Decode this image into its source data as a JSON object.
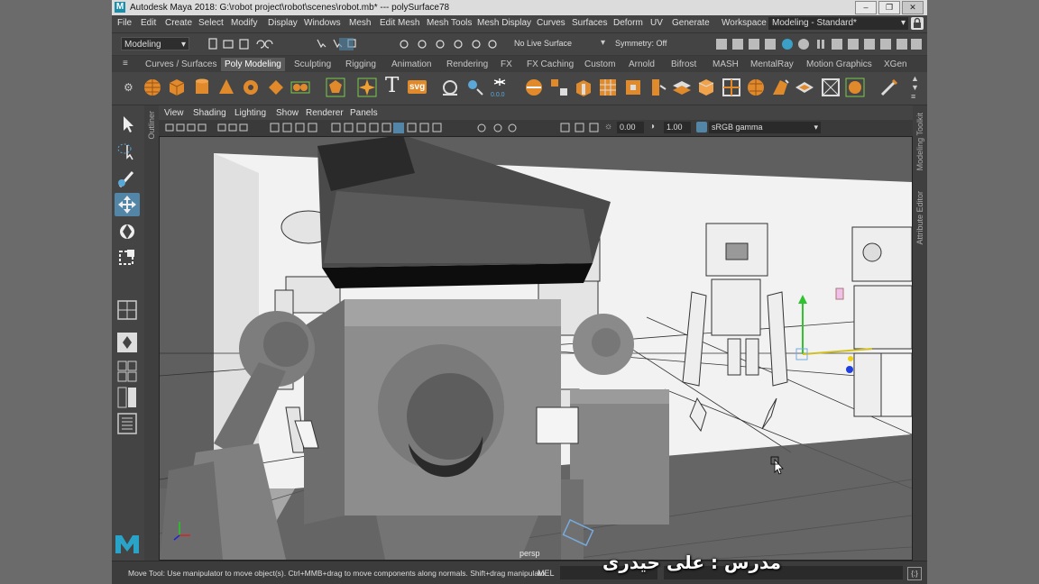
{
  "window": {
    "title": "Autodesk Maya 2018: G:\\robot project\\robot\\scenes\\robot.mb*  ---  polySurface78",
    "logo": "M"
  },
  "menu": [
    "File",
    "Edit",
    "Create",
    "Select",
    "Modify",
    "Display",
    "Windows",
    "Mesh",
    "Edit Mesh",
    "Mesh Tools",
    "Mesh Display",
    "Curves",
    "Surfaces",
    "Deform",
    "UV",
    "Generate"
  ],
  "workspace": {
    "label": "Workspace :",
    "value": "Modeling - Standard*"
  },
  "statusline": {
    "mode": "Modeling",
    "live_surface": "No Live Surface",
    "symmetry": "Symmetry: Off"
  },
  "shelf_tabs": [
    "Curves / Surfaces",
    "Poly Modeling",
    "Sculpting",
    "Rigging",
    "Animation",
    "Rendering",
    "FX",
    "FX Caching",
    "Custom",
    "Arnold",
    "Bifrost",
    "MASH",
    "MentalRay",
    "Motion Graphics",
    "XGen"
  ],
  "active_shelf_tab": "Poly Modeling",
  "shelf_text_icons": {
    "text_tool": "T",
    "svg_tool": "svg"
  },
  "panel": {
    "menu": [
      "View",
      "Shading",
      "Lighting",
      "Show",
      "Renderer",
      "Panels"
    ],
    "exposure": "0.00",
    "gamma": "1.00",
    "color_space": "sRGB gamma",
    "camera": "persp"
  },
  "side_labels": {
    "outliner": "Outliner",
    "modeling_toolkit": "Modeling Toolkit",
    "attribute_editor": "Attribute Editor"
  },
  "help_line": "Move Tool: Use manipulator to move object(s). Ctrl+MMB+drag to move components along normals. Shift+drag manipulato",
  "command_line": {
    "label": "MEL"
  },
  "overlay": {
    "teacher": "مدرس : علی حیدری"
  },
  "colors": {
    "accent": "#5285a6",
    "shelf_orange": "#e08a2c",
    "viewport_bg": "#5f5f5f"
  }
}
